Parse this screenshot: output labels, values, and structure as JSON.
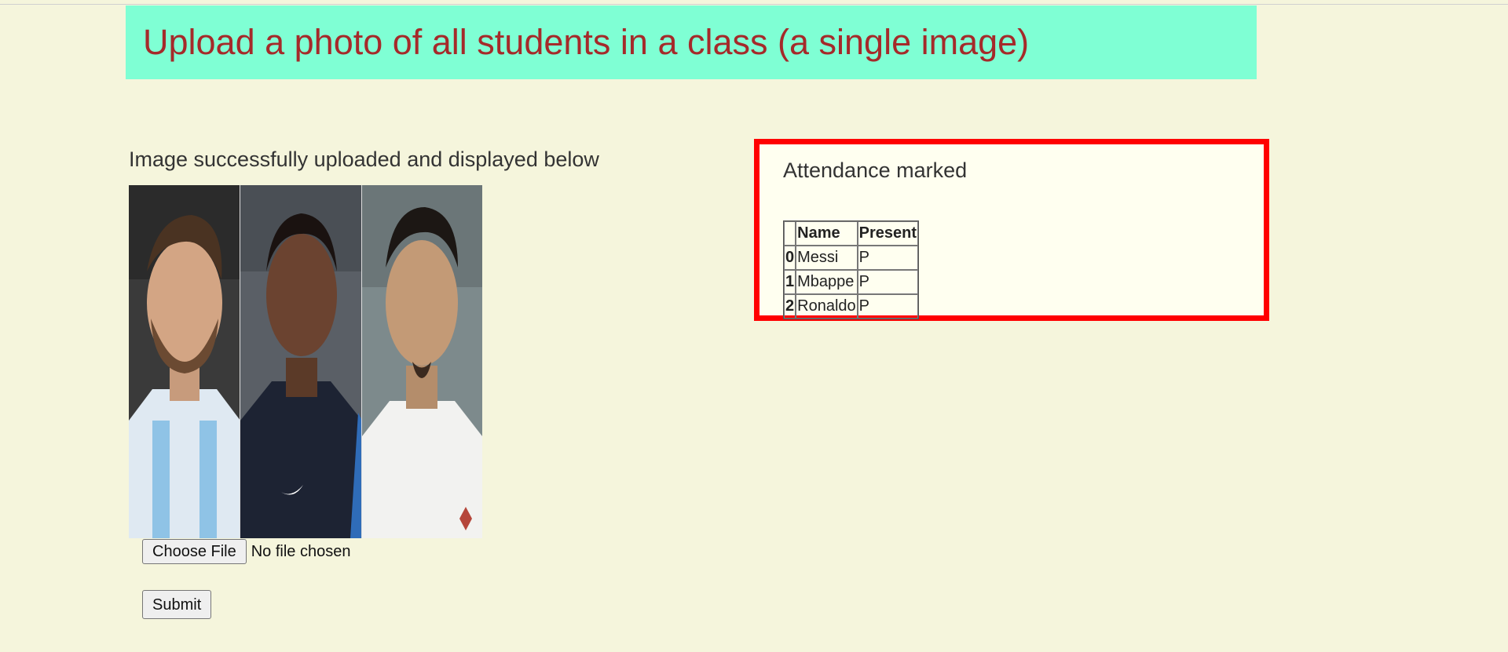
{
  "header": {
    "title": "Upload a photo of all students in a class (a single image)"
  },
  "upload": {
    "message": "Image successfully uploaded and displayed below",
    "choose_file_label": "Choose File",
    "file_status": "No file chosen",
    "submit_label": "Submit"
  },
  "attendance": {
    "title": "Attendance marked",
    "columns": [
      "",
      "Name",
      "Present"
    ],
    "rows": [
      {
        "index": "0",
        "name": "Messi",
        "present": "P"
      },
      {
        "index": "1",
        "name": "Mbappe",
        "present": "P"
      },
      {
        "index": "2",
        "name": "Ronaldo",
        "present": "P"
      }
    ]
  },
  "colors": {
    "page_background": "#f5f5dc",
    "header_background": "#7fffd4",
    "header_text": "#a52a2a",
    "attendance_border": "#ff0000",
    "attendance_background": "#fffff0"
  }
}
